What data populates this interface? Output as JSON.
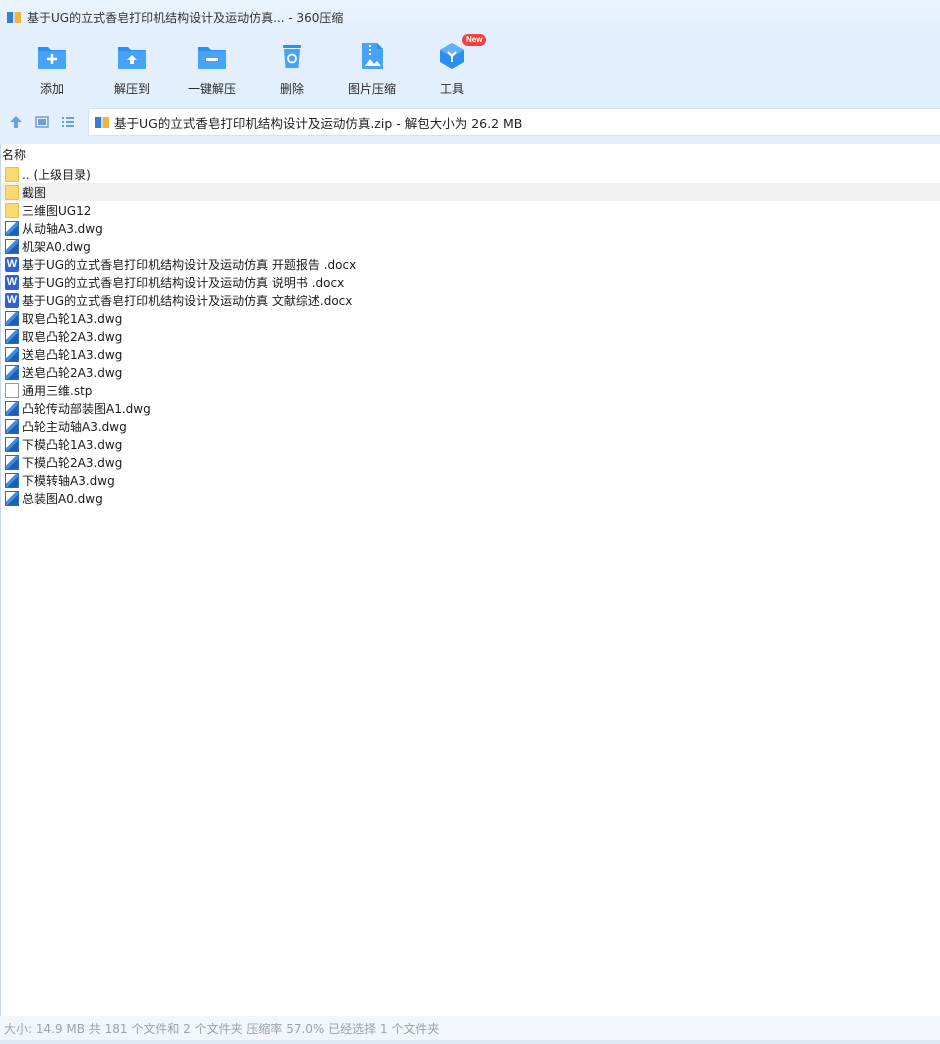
{
  "window": {
    "title": "基于UG的立式香皂打印机结构设计及运动仿真... - 360压缩"
  },
  "toolbar": {
    "items": [
      {
        "id": "add",
        "label": "添加",
        "icon": "add-icon"
      },
      {
        "id": "extract-to",
        "label": "解压到",
        "icon": "extract-to-icon"
      },
      {
        "id": "one-click-extract",
        "label": "一键解压",
        "icon": "one-click-extract-icon"
      },
      {
        "id": "delete",
        "label": "删除",
        "icon": "recycle-bin-icon"
      },
      {
        "id": "image-compress",
        "label": "图片压缩",
        "icon": "image-compress-icon"
      },
      {
        "id": "tools",
        "label": "工具",
        "icon": "tools-icon",
        "badge": "New"
      }
    ]
  },
  "nav": {
    "path": "基于UG的立式香皂打印机结构设计及运动仿真.zip - 解包大小为 26.2 MB"
  },
  "list": {
    "column_name": "名称",
    "rows": [
      {
        "name": ".. (上级目录)",
        "type": "folder"
      },
      {
        "name": "截图",
        "type": "folder",
        "selected": true
      },
      {
        "name": "三维图UG12",
        "type": "folder"
      },
      {
        "name": "从动轴A3.dwg",
        "type": "dwg"
      },
      {
        "name": "机架A0.dwg",
        "type": "dwg"
      },
      {
        "name": "基于UG的立式香皂打印机结构设计及运动仿真 开题报告 .docx",
        "type": "docx"
      },
      {
        "name": "基于UG的立式香皂打印机结构设计及运动仿真 说明书 .docx",
        "type": "docx"
      },
      {
        "name": "基于UG的立式香皂打印机结构设计及运动仿真 文献综述.docx",
        "type": "docx"
      },
      {
        "name": "取皂凸轮1A3.dwg",
        "type": "dwg"
      },
      {
        "name": "取皂凸轮2A3.dwg",
        "type": "dwg"
      },
      {
        "name": "送皂凸轮1A3.dwg",
        "type": "dwg"
      },
      {
        "name": "送皂凸轮2A3.dwg",
        "type": "dwg"
      },
      {
        "name": "通用三维.stp",
        "type": "file"
      },
      {
        "name": "凸轮传动部装图A1.dwg",
        "type": "dwg"
      },
      {
        "name": "凸轮主动轴A3.dwg",
        "type": "dwg"
      },
      {
        "name": "下模凸轮1A3.dwg",
        "type": "dwg"
      },
      {
        "name": "下模凸轮2A3.dwg",
        "type": "dwg"
      },
      {
        "name": "下模转轴A3.dwg",
        "type": "dwg"
      },
      {
        "name": "总装图A0.dwg",
        "type": "dwg"
      }
    ]
  },
  "status": {
    "text": "大小: 14.9 MB 共 181 个文件和 2 个文件夹 压缩率 57.0% 已经选择 1 个文件夹"
  },
  "colors": {
    "accent": "#2a8ff0",
    "toolbar_bg": "#e3effc",
    "folder": "#fbd96e",
    "word_blue": "#2f62d0",
    "badge_red": "#f5413d"
  }
}
